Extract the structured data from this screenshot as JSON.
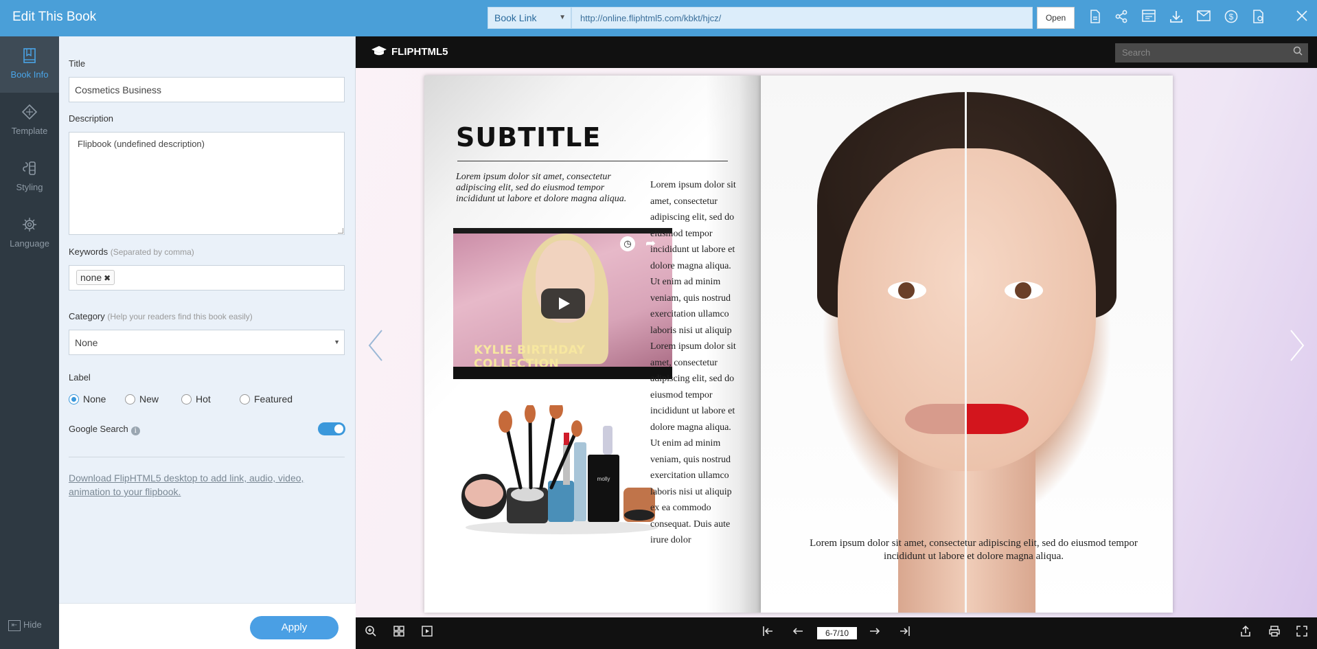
{
  "header": {
    "title": "Edit This Book",
    "link_type": "Book Link",
    "link_url": "http://online.fliphtml5.com/kbkt/hjcz/",
    "open_label": "Open"
  },
  "rail": {
    "items": [
      {
        "label": "Book Info",
        "icon": "book-info-icon"
      },
      {
        "label": "Template",
        "icon": "template-icon"
      },
      {
        "label": "Styling",
        "icon": "styling-icon"
      },
      {
        "label": "Language",
        "icon": "language-icon"
      }
    ],
    "hide_label": "Hide"
  },
  "form": {
    "title_label": "Title",
    "title_value": "Cosmetics Business",
    "description_label": "Description",
    "description_value": "Flipbook (undefined description)",
    "keywords_label": "Keywords",
    "keywords_hint": "(Separated by comma)",
    "keywords": [
      "none"
    ],
    "category_label": "Category",
    "category_hint": "(Help your readers find this book easily)",
    "category_value": "None",
    "label_label": "Label",
    "label_options": [
      "None",
      "New",
      "Hot",
      "Featured"
    ],
    "label_selected": "None",
    "google_search_label": "Google Search",
    "google_search_on": true,
    "download_text": "Download FlipHTML5 desktop to add link, audio, video, animation to your flipbook.",
    "apply_label": "Apply"
  },
  "viewer": {
    "brand": "FLIPHTML5",
    "search_placeholder": "Search",
    "page_indicator": "6-7/10",
    "left_page": {
      "subtitle": "SUBTITLE",
      "intro": "Lorem ipsum dolor sit amet, consectetur adipiscing elit, sed do eiusmod tempor incididunt ut labore et dolore magna aliqua.",
      "video_caption": "KYLIE BIRTHDAY COLLECTION",
      "body": "Lorem ipsum dolor sit amet, consectetur adipiscing elit, sed do eiusmod tempor incididunt ut labore et dolore magna aliqua. Ut enim ad minim veniam, quis nostrud exercitation ullamco laboris nisi ut aliquip Lorem ipsum dolor sit amet, consectetur adipiscing elit, sed do eiusmod tempor incididunt ut labore et dolore magna aliqua. Ut enim ad minim veniam, quis nostrud exercitation ullamco laboris nisi ut aliquip ex ea commodo consequat. Duis aute irure dolor"
    },
    "right_page": {
      "caption": "Lorem ipsum dolor sit amet, consectetur adipiscing elit, sed do eiusmod tempor incididunt ut labore et dolore magna aliqua."
    }
  },
  "colors": {
    "topbar": "#4a9fd8",
    "rail": "#2e3942",
    "panel": "#eaf1f9",
    "accent": "#3b98db",
    "lips_red": "#d3151d"
  }
}
